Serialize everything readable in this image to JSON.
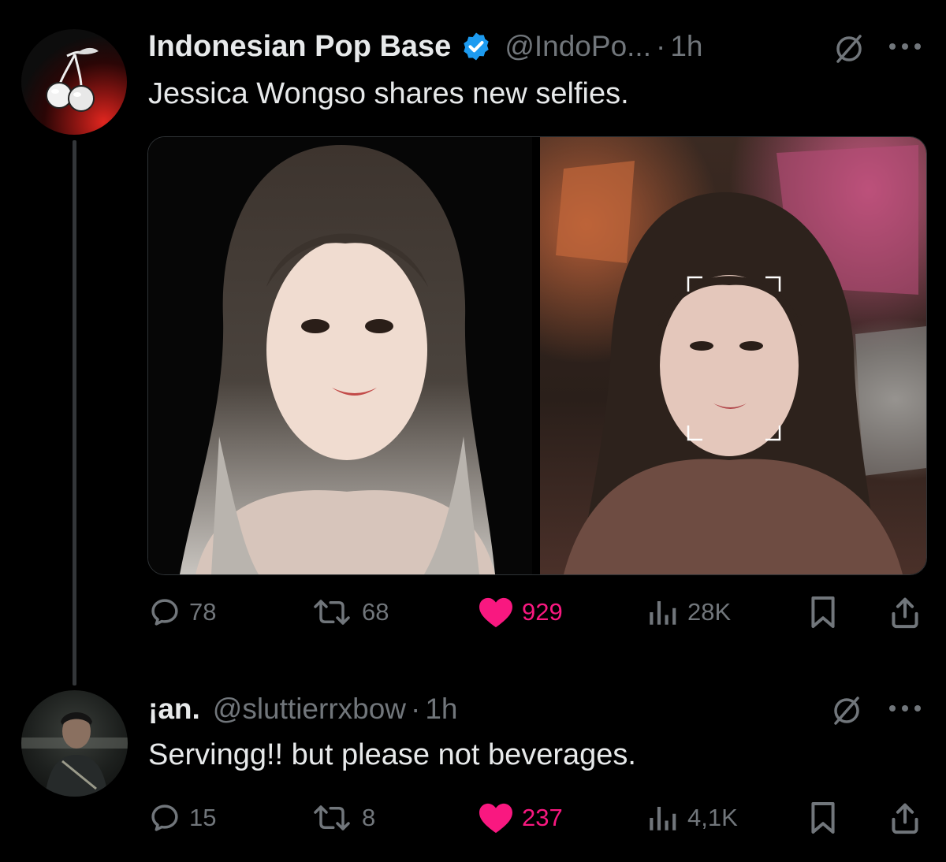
{
  "tweet1": {
    "author_name": "Indonesian Pop Base",
    "handle": "@IndoPo...",
    "separator": "·",
    "time": "1h",
    "text": "Jessica Wongso shares new selfies.",
    "icons": {
      "verified": "verified-badge-icon",
      "mute": "mute-icon",
      "more": "more-icon"
    },
    "stats": {
      "replies": "78",
      "reposts": "68",
      "likes": "929",
      "views": "28K"
    },
    "liked": true
  },
  "tweet2": {
    "author_name": "¡an.",
    "handle": "@sluttierrxbow",
    "separator": "·",
    "time": "1h",
    "text": "Servingg!! but please not beverages.",
    "stats": {
      "replies": "15",
      "reposts": "8",
      "likes": "237",
      "views": "4,1K"
    },
    "liked": true
  },
  "colors": {
    "background": "#000000",
    "text": "#e7e9ea",
    "secondary": "#71767b",
    "like": "#f91880",
    "verified": "#1d9bf0"
  }
}
